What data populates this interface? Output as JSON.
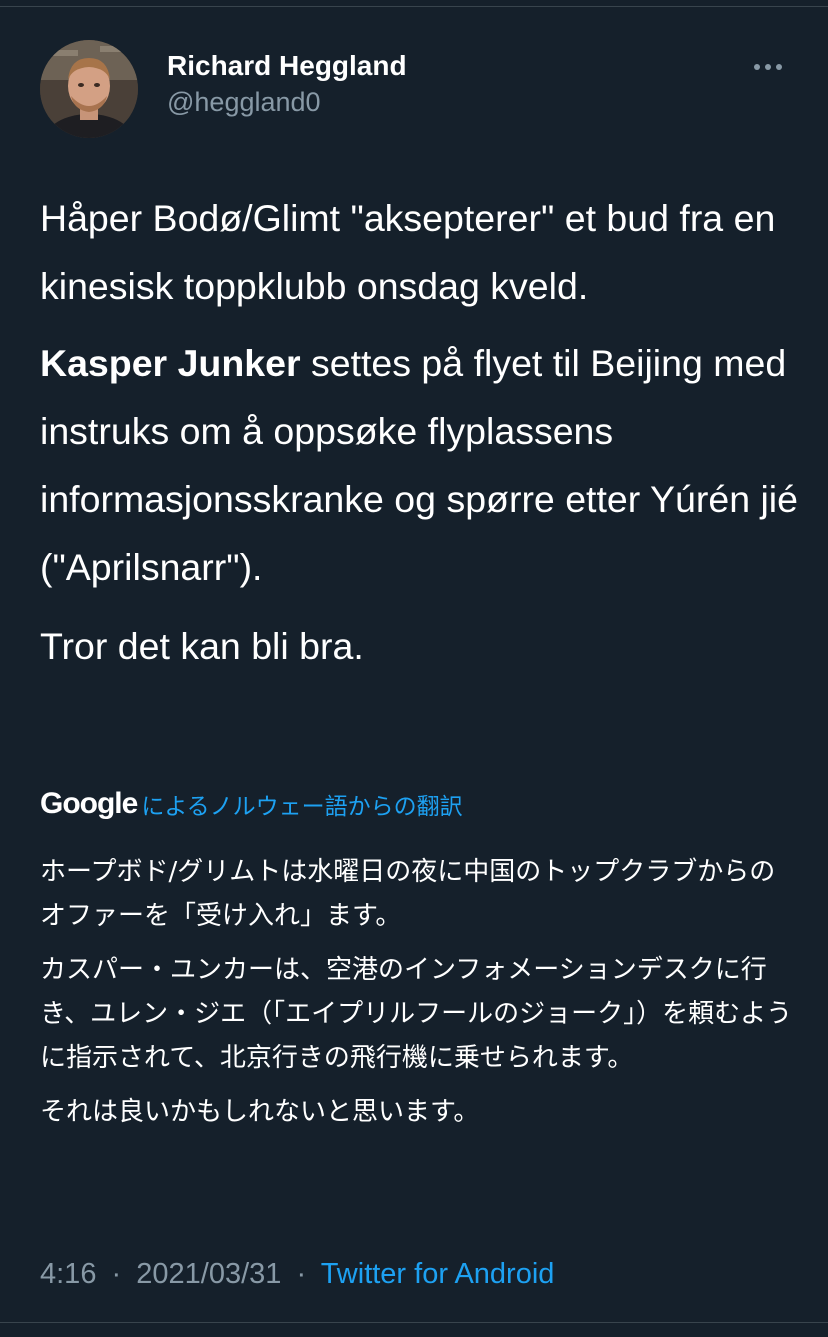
{
  "tweet": {
    "author": {
      "display_name": "Richard Heggland",
      "handle": "@heggland0"
    },
    "more_icon": "ellipsis-icon",
    "paragraph1": "Håper Bodø/Glimt \"aksepterer\" et bud fra en kinesisk toppklubb onsdag kveld.",
    "paragraph2_bold": "Kasper Junker",
    "paragraph2_rest": " settes på flyet til Beijing med instruks om å oppsøke flyplassens informasjonsskranke og spørre etter Yúrén jié (\"Aprilsnarr\").",
    "paragraph3": "Tror det kan bli bra.",
    "translation": {
      "provider": "Google",
      "link_text": "によるノルウェー語からの翻訳",
      "paragraphs": [
        "ホープボド/グリムトは水曜日の夜に中国のトップクラブからのオファーを「受け入れ」ます。",
        "カスパー・ユンカーは、空港のインフォメーションデスクに行き、ユレン・ジエ（「エイプリルフールのジョーク」）を頼むように指示されて、北京行きの飛行機に乗せられます。",
        "それは良いかもしれないと思います。"
      ]
    },
    "meta": {
      "time": "4:16",
      "separator": "·",
      "date": "2021/03/31",
      "source": "Twitter for Android"
    }
  },
  "colors": {
    "background": "#15202b",
    "text": "#ffffff",
    "secondary": "#8899a6",
    "accent": "#1da1f2",
    "divider": "#38444d"
  }
}
